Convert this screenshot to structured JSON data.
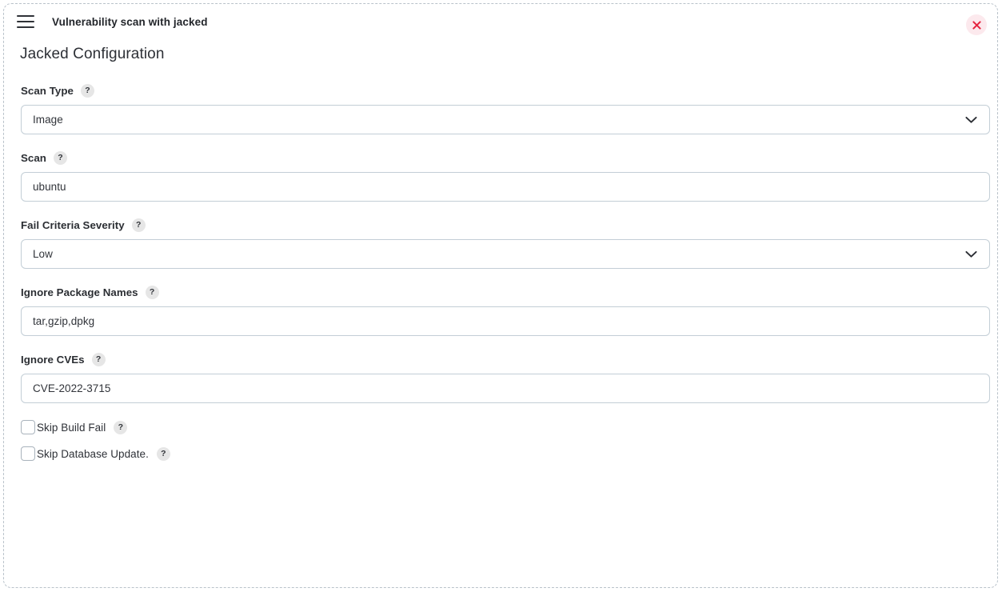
{
  "window": {
    "menu_icon": "hamburger-menu-icon",
    "title": "Vulnerability scan with jacked",
    "close_icon": "close-x-icon",
    "close_bg_color": "#fce9ed",
    "close_fg_color": "#e5243f"
  },
  "page": {
    "heading": "Jacked Configuration"
  },
  "help_glyph": "?",
  "fields": [
    {
      "label": "Scan Type",
      "type": "select",
      "value": "Image",
      "help": "?",
      "chevron": "chevron-down-icon"
    },
    {
      "label": "Scan",
      "type": "text",
      "value": "ubuntu",
      "help": "?"
    },
    {
      "label": "Fail Criteria Severity",
      "type": "select",
      "value": "Low",
      "help": "?",
      "chevron": "chevron-down-icon"
    },
    {
      "label": "Ignore Package Names",
      "type": "text",
      "value": "tar,gzip,dpkg",
      "help": "?"
    },
    {
      "label": "Ignore CVEs",
      "type": "text",
      "value": "CVE-2022-3715",
      "help": "?"
    }
  ],
  "checkboxes": [
    {
      "label": "Skip Build Fail",
      "checked": false,
      "help": "?"
    },
    {
      "label": "Skip Database Update.",
      "checked": false,
      "help": "?"
    }
  ],
  "theme": {
    "border_color": "#c3ced6",
    "dashed_border_color": "#b9c2ca",
    "text_color": "#2b2e33",
    "help_bg": "#e6e6e6"
  }
}
